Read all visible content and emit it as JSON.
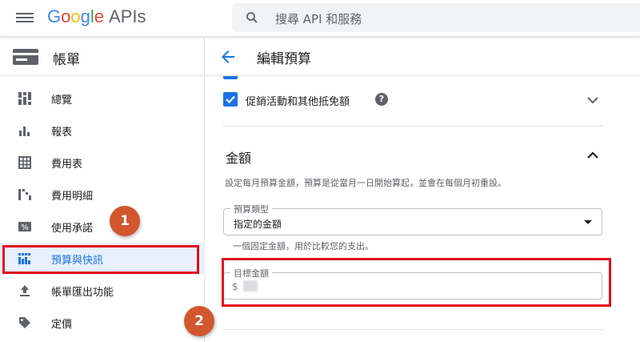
{
  "header": {
    "logo_google": [
      "G",
      "o",
      "o",
      "g",
      "l",
      "e"
    ],
    "logo_apis": "APIs",
    "search_placeholder": "搜尋 API 和服務"
  },
  "sidebar": {
    "title": "帳單",
    "items": [
      {
        "label": "總覽",
        "icon": "dashboard-icon"
      },
      {
        "label": "報表",
        "icon": "bar-chart-icon"
      },
      {
        "label": "費用表",
        "icon": "table-icon"
      },
      {
        "label": "費用明細",
        "icon": "breakdown-icon"
      },
      {
        "label": "使用承諾",
        "icon": "percent-icon"
      },
      {
        "label": "預算與快訊",
        "icon": "budget-icon",
        "active": true
      },
      {
        "label": "帳單匯出功能",
        "icon": "upload-icon"
      },
      {
        "label": "定價",
        "icon": "tag-icon"
      }
    ]
  },
  "main": {
    "title": "編輯預算",
    "checkbox_label": "促銷活動和其他抵免額",
    "checkbox_checked": true,
    "help_glyph": "?",
    "amount_section": {
      "title": "金額",
      "description": "設定每月預算金額，預算是從當月一日開始算起，並會在每個月初重設。",
      "budget_type_label": "預算類型",
      "budget_type_value": "指定的金額",
      "budget_type_helper": "一個固定金額，用於比較您的支出。",
      "target_amount_label": "目標金額",
      "target_amount_prefix": "$"
    }
  },
  "annotations": {
    "badge1": "1",
    "badge2": "2",
    "highlight_color": "#e0101f",
    "badge_color": "#d2562e"
  },
  "colors": {
    "accent": "#1a73e8",
    "text": "#202124",
    "muted": "#5f6368"
  }
}
